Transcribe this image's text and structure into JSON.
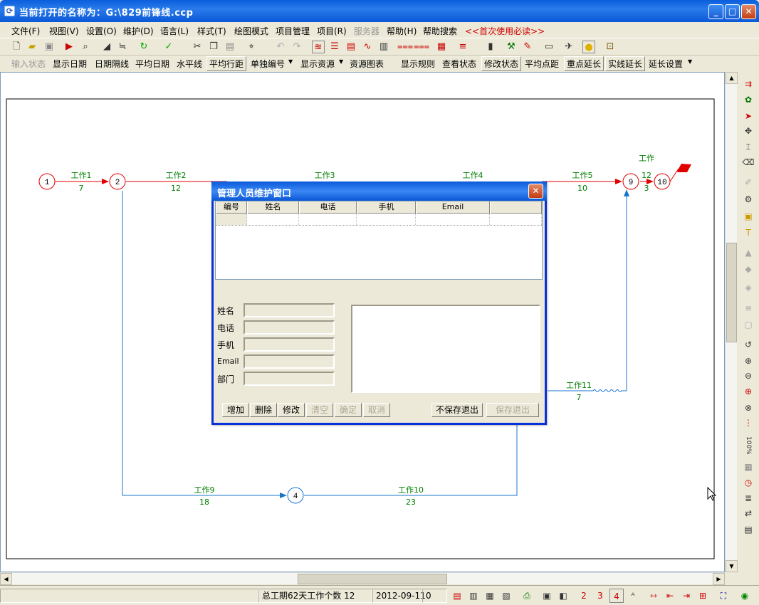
{
  "window": {
    "title": "当前打开的名称为：G:\\829前锋线.ccp",
    "minimize": "_",
    "maximize": "□",
    "close": "✕"
  },
  "menu": [
    "文件(F)",
    "视图(V)",
    "设置(O)",
    "维护(D)",
    "语言(L)",
    "样式(T)",
    "绘图模式",
    "项目管理",
    "项目(R)",
    "服务器",
    "帮助(H)",
    "帮助搜索",
    "<<首次使用必读>>"
  ],
  "toolbar2": {
    "items": [
      "输入状态",
      "显示日期",
      "日期隔线",
      "平均日期",
      "水平线",
      "平均行距",
      "单独编号",
      "显示资源",
      "资源图表",
      "显示规则",
      "查看状态",
      "修改状态",
      "平均点距",
      "重点延长",
      "实线延长",
      "延长设置"
    ]
  },
  "diagram": {
    "nodes": [
      "1",
      "2",
      "4",
      "9",
      "10"
    ],
    "red_activities": [
      {
        "name": "工作1",
        "duration": "7"
      },
      {
        "name": "工作2",
        "duration": "12"
      },
      {
        "name": "工作3",
        "duration": ""
      },
      {
        "name": "工作4",
        "duration": ""
      },
      {
        "name": "工作5",
        "duration": "10"
      }
    ],
    "work12_name": "工作",
    "work12_duration": "12",
    "work12_extra": "3",
    "blue_activities": [
      {
        "name": "工作9",
        "duration": "18"
      },
      {
        "name": "工作10",
        "duration": "23"
      },
      {
        "name": "工作11",
        "duration": "7"
      }
    ]
  },
  "dialog": {
    "title": "管理人员维护窗口",
    "columns": [
      "编号",
      "姓名",
      "电话",
      "手机",
      "Email",
      ""
    ],
    "fields": [
      {
        "label": "姓名",
        "value": ""
      },
      {
        "label": "电话",
        "value": ""
      },
      {
        "label": "手机",
        "value": ""
      },
      {
        "label": "Email",
        "value": ""
      },
      {
        "label": "部门",
        "value": ""
      }
    ],
    "buttons": {
      "add": "增加",
      "delete": "删除",
      "modify": "修改",
      "clear": "清空",
      "confirm": "确定",
      "cancel": "取消",
      "exit_nosave": "不保存退出",
      "exit_save": "保存退出"
    }
  },
  "status": {
    "summary": "总工期62天工作个数 12",
    "date": "2012-09-11",
    "count": "0"
  },
  "right_tools": {
    "zoom_label": "100%"
  },
  "colors": {
    "critical": "#E00000",
    "normal": "#1874CD",
    "label": "#008000",
    "accent": "#0A5EDC"
  }
}
